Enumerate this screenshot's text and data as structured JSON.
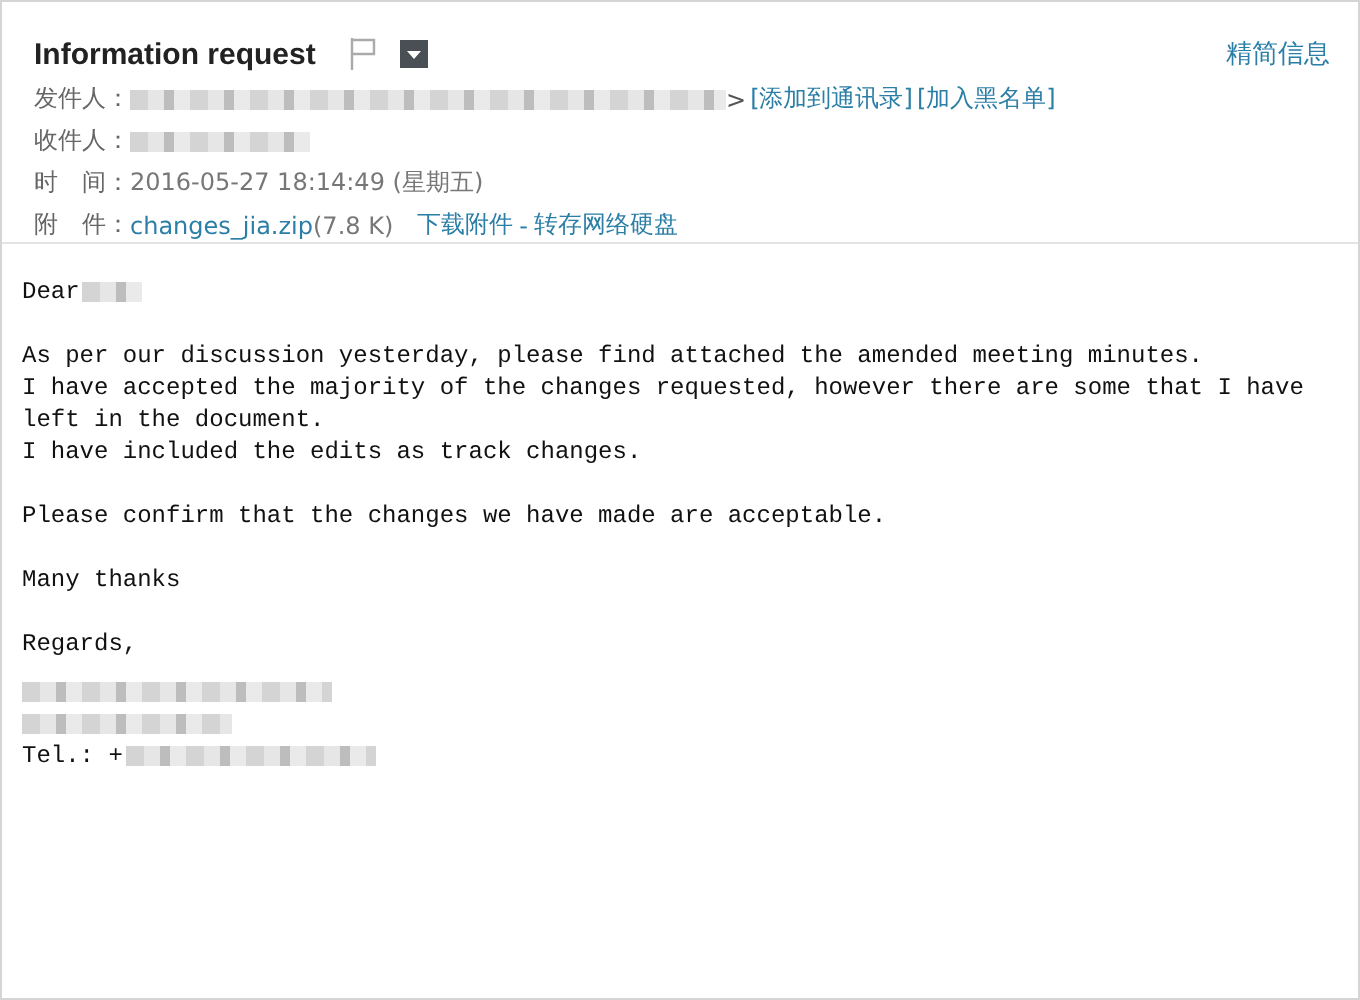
{
  "header": {
    "title": "Information request",
    "summary_link": "精简信息"
  },
  "sender": {
    "label": "发件人：",
    "bracket": ">",
    "actions": [
      "[添加到通讯录]",
      "[加入黑名单]"
    ]
  },
  "recipient": {
    "label": "收件人："
  },
  "time": {
    "label": "时　间：",
    "value": "2016-05-27 18:14:49 (星期五)"
  },
  "attachment": {
    "label": "附　件：",
    "file": "changes_jia.zip",
    "size": "(7.8 K)",
    "actions": [
      "下载附件",
      "转存网络硬盘"
    ],
    "separator": "-"
  },
  "body": {
    "greeting": "Dear",
    "paragraphs": [
      [
        "As per our discussion yesterday, please find attached the amended meeting minutes.",
        "I have accepted the majority of the changes requested, however there are some that I have",
        "left in the document.",
        "I have included the edits as track changes."
      ],
      [
        "Please confirm that the changes we have made are acceptable."
      ],
      [
        "Many thanks"
      ]
    ],
    "signature": {
      "closing": "Regards,",
      "tel": "Tel.: +"
    }
  }
}
